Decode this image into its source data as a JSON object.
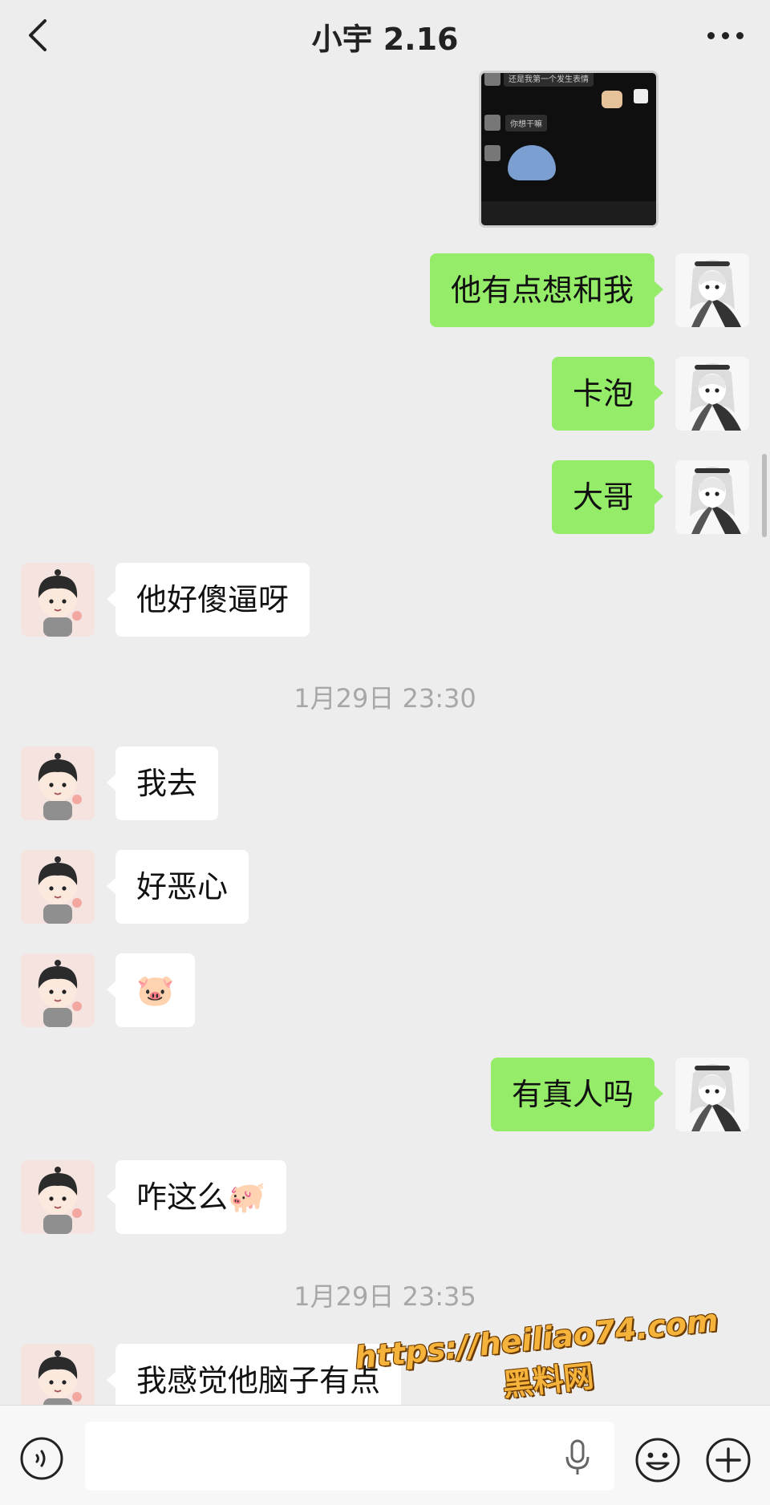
{
  "header": {
    "title": "小宇 2.16"
  },
  "shared_image": {
    "lines": [
      "还是我第一个发生表情",
      "你想干嘛"
    ]
  },
  "messages": {
    "m1": "他有点想和我",
    "m2": "卡泡",
    "m3": "大哥",
    "m4": "他好傻逼呀",
    "t1": "1月29日 23:30",
    "m5": "我去",
    "m6": "好恶心",
    "m7": "🐷",
    "m8": "有真人吗",
    "m9": "咋这么🐖",
    "t2": "1月29日 23:35",
    "m10": "我感觉他脑子有点"
  },
  "input": {
    "placeholder": ""
  },
  "watermark": {
    "url": "https://heiliao74.com",
    "name": "黑料网"
  },
  "colors": {
    "self_bubble": "#95ec69",
    "other_bubble": "#ffffff",
    "background": "#ededed"
  }
}
